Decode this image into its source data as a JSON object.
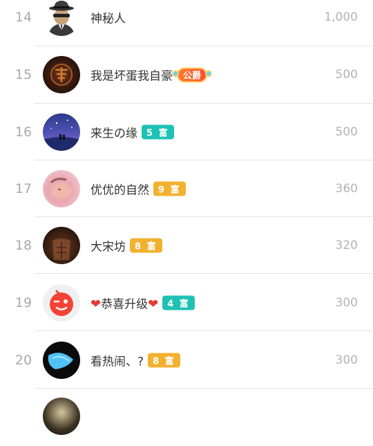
{
  "rows": [
    {
      "rank": "14",
      "name": "神秘人",
      "value": "1,000",
      "badge": null
    },
    {
      "rank": "15",
      "name": "我是坏蛋我自豪",
      "value": "500",
      "title_badge": "公爵"
    },
    {
      "rank": "16",
      "name": "来生の缘",
      "value": "500",
      "badge": "5 富",
      "badge_color": "teal"
    },
    {
      "rank": "17",
      "name": "优优的自然",
      "value": "360",
      "badge": "9 富",
      "badge_color": "orange"
    },
    {
      "rank": "18",
      "name": "大宋坊",
      "value": "320",
      "badge": "8 富",
      "badge_color": "orange"
    },
    {
      "rank": "19",
      "name": "恭喜升级",
      "value": "300",
      "badge": "4 富",
      "badge_color": "teal",
      "hearts": "❤"
    },
    {
      "rank": "20",
      "name": "看热闹、?",
      "value": "300",
      "badge": "8 富",
      "badge_color": "orange"
    }
  ],
  "colors": {
    "teal": "#1ec2b4",
    "orange": "#f3b130",
    "rank": "#a9a9a9",
    "value": "#b3b3b3"
  }
}
